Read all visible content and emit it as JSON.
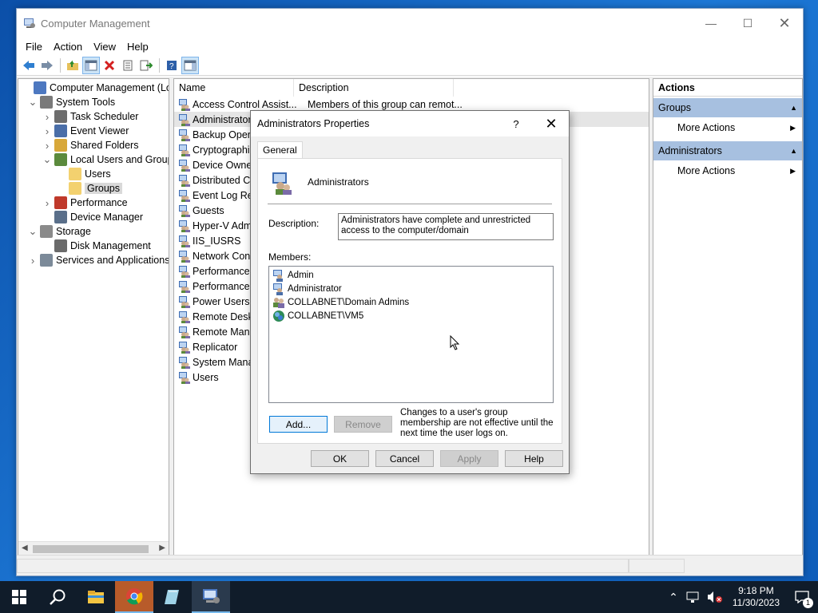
{
  "window": {
    "title": "Computer Management",
    "menu": [
      "File",
      "Action",
      "View",
      "Help"
    ]
  },
  "tree": [
    {
      "label": "Computer Management (Local",
      "icon": "computer-management-icon",
      "exp": ""
    },
    {
      "label": "System Tools",
      "icon": "system-tools-icon",
      "exp": "v"
    },
    {
      "label": "Task Scheduler",
      "icon": "task-scheduler-icon",
      "exp": ">"
    },
    {
      "label": "Event Viewer",
      "icon": "event-viewer-icon",
      "exp": ">"
    },
    {
      "label": "Shared Folders",
      "icon": "shared-folders-icon",
      "exp": ">"
    },
    {
      "label": "Local Users and Groups",
      "icon": "users-groups-icon",
      "exp": "v"
    },
    {
      "label": "Users",
      "icon": "folder-icon",
      "exp": ""
    },
    {
      "label": "Groups",
      "icon": "folder-icon",
      "exp": "",
      "selected": true
    },
    {
      "label": "Performance",
      "icon": "performance-icon",
      "exp": ">"
    },
    {
      "label": "Device Manager",
      "icon": "device-manager-icon",
      "exp": ""
    },
    {
      "label": "Storage",
      "icon": "storage-icon",
      "exp": "v"
    },
    {
      "label": "Disk Management",
      "icon": "disk-management-icon",
      "exp": ""
    },
    {
      "label": "Services and Applications",
      "icon": "services-icon",
      "exp": ">"
    }
  ],
  "list": {
    "headers": {
      "name": "Name",
      "description": "Description"
    },
    "rows": [
      {
        "name": "Access Control Assist...",
        "description": "Members of this group can remot..."
      },
      {
        "name": "Administrators",
        "description": "",
        "selected": true
      },
      {
        "name": "Backup Operat",
        "description": ""
      },
      {
        "name": "Cryptographic",
        "description": ""
      },
      {
        "name": "Device Owners",
        "description": ""
      },
      {
        "name": "Distributed CO",
        "description": ""
      },
      {
        "name": "Event Log Rea",
        "description": ""
      },
      {
        "name": "Guests",
        "description": ""
      },
      {
        "name": "Hyper-V Admi",
        "description": ""
      },
      {
        "name": "IIS_IUSRS",
        "description": ""
      },
      {
        "name": "Network Conf",
        "description": ""
      },
      {
        "name": "Performance L",
        "description": ""
      },
      {
        "name": "Performance M",
        "description": ""
      },
      {
        "name": "Power Users",
        "description": ""
      },
      {
        "name": "Remote Deskto",
        "description": ""
      },
      {
        "name": "Remote Mana",
        "description": ""
      },
      {
        "name": "Replicator",
        "description": ""
      },
      {
        "name": "System Manag",
        "description": ""
      },
      {
        "name": "Users",
        "description": ""
      }
    ]
  },
  "actions": {
    "header": "Actions",
    "sections": [
      {
        "title": "Groups",
        "item": "More Actions"
      },
      {
        "title": "Administrators",
        "item": "More Actions"
      }
    ]
  },
  "dialog": {
    "title": "Administrators Properties",
    "help_glyph": "?",
    "tab": "General",
    "group_name": "Administrators",
    "description_label": "Description:",
    "description": "Administrators have complete and unrestricted access to the computer/domain",
    "members_label": "Members:",
    "members": [
      {
        "name": "Admin",
        "icon": "user-icon"
      },
      {
        "name": "Administrator",
        "icon": "user-icon"
      },
      {
        "name": "COLLABNET\\Domain Admins",
        "icon": "domain-group-icon"
      },
      {
        "name": "COLLABNET\\VM5",
        "icon": "computer-account-icon"
      }
    ],
    "add": "Add...",
    "remove": "Remove",
    "note": "Changes to a user's group membership are not effective until the next time the user logs on.",
    "ok": "OK",
    "cancel": "Cancel",
    "apply": "Apply",
    "help": "Help"
  },
  "taskbar": {
    "time": "9:18 PM",
    "date": "11/30/2023",
    "notification_count": "1"
  },
  "colors": {
    "accent": "#0078d7",
    "action_section": "#a7c0e0",
    "taskbar": "#101c2a"
  }
}
